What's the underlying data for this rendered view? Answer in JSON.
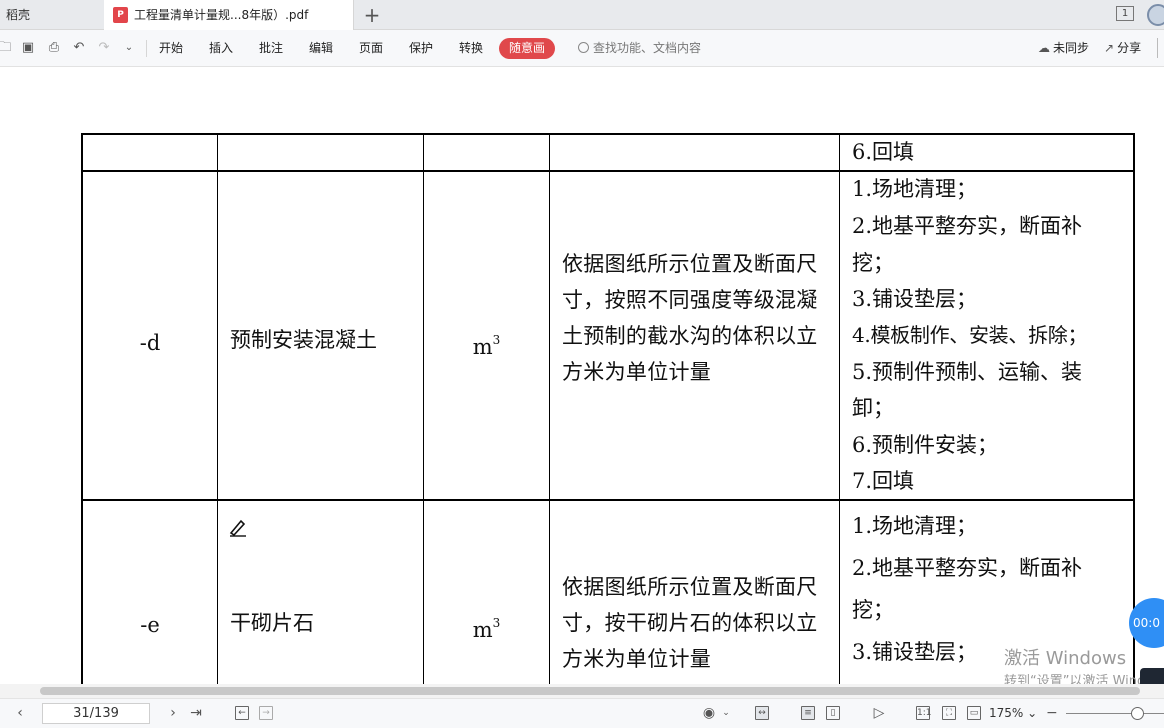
{
  "tabs": {
    "home": "稻壳",
    "active_title": "工程量清单计量规...8年版）.pdf",
    "pdf_badge": "P",
    "add": "+",
    "window_count": "1"
  },
  "toolbar": {
    "menu": [
      "开始",
      "插入",
      "批注",
      "编辑",
      "页面",
      "保护",
      "转换"
    ],
    "highlight": "随意画",
    "search_placeholder": "查找功能、文档内容",
    "sync": "未同步",
    "share": "分享"
  },
  "table": {
    "rows": [
      {
        "code": "",
        "name": "",
        "unit": "",
        "description": "",
        "work": [
          "6.回填"
        ]
      },
      {
        "code": "-d",
        "name": "预制安装混凝土",
        "unit": "m",
        "unit_sup": "3",
        "description": "依据图纸所示位置及断面尺寸，按照不同强度等级混凝土预制的截水沟的体积以立方米为单位计量",
        "work": [
          "1.场地清理；",
          "2.地基平整夯实，断面补",
          "挖；",
          "3.铺设垫层；",
          "4.模板制作、安装、拆除；",
          "5.预制件预制、运输、装",
          "卸；",
          "6.预制件安装；",
          "7.回填"
        ]
      },
      {
        "code": "-e",
        "name": "干砌片石",
        "unit": "m",
        "unit_sup": "3",
        "description": "依据图纸所示位置及断面尺寸，按干砌片石的体积以立方米为单位计量",
        "work": [
          "1.场地清理；",
          "2.地基平整夯实，断面补",
          "挖；",
          "3.铺设垫层；"
        ]
      }
    ]
  },
  "overlay": {
    "watermark_title": "激活 Windows",
    "watermark_sub": "转到“设置”以激活 Windows。",
    "timer": "00:0"
  },
  "statusbar": {
    "page": "31/139",
    "zoom": "175%",
    "fit_label": "1:1"
  }
}
